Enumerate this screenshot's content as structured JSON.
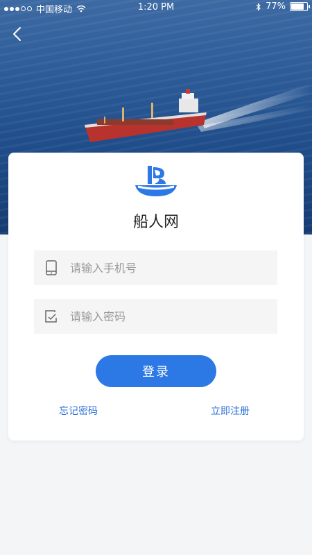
{
  "status_bar": {
    "carrier": "中国移动",
    "time": "1:20 PM",
    "battery_percent": "77%",
    "battery_level": 0.77,
    "signal_bars_filled": 3,
    "signal_bars_total": 5
  },
  "header": {
    "back_icon": "chevron-left-icon"
  },
  "app": {
    "name": "船人网",
    "logo_icon": "sail-ship-logo",
    "brand_color": "#2c78e4"
  },
  "login_form": {
    "phone_placeholder": "请输入手机号",
    "phone_value": "",
    "phone_icon": "phone-icon",
    "password_placeholder": "请输入密码",
    "password_value": "",
    "password_icon": "password-icon",
    "submit_label": "登录",
    "forgot_password_label": "忘记密码",
    "register_label": "立即注册"
  }
}
